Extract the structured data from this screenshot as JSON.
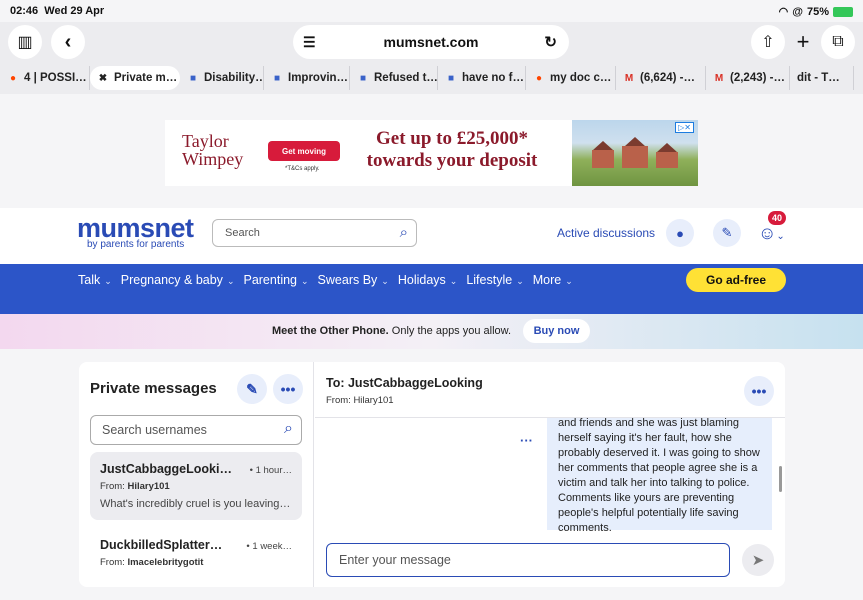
{
  "status": {
    "time": "02:46",
    "date": "Wed 29 Apr",
    "battery": "75%"
  },
  "browser": {
    "url": "mumsnet.com",
    "tabs": [
      {
        "label": "4 | POSSI…",
        "icon": "reddit-icon"
      },
      {
        "label": "Private m…",
        "icon": "close-icon"
      },
      {
        "label": "Disability…",
        "icon": "site-icon"
      },
      {
        "label": "Improvin…",
        "icon": "site-icon"
      },
      {
        "label": "Refused t…",
        "icon": "site-icon"
      },
      {
        "label": "have no f…",
        "icon": "site-icon"
      },
      {
        "label": "my doc c…",
        "icon": "reddit-icon"
      },
      {
        "label": "(6,624) -…",
        "icon": "gmail-icon"
      },
      {
        "label": "(2,243) -…",
        "icon": "gmail-icon"
      },
      {
        "label": "dit - T…",
        "icon": ""
      }
    ]
  },
  "ad": {
    "brand_line1": "Taylor",
    "brand_line2": "Wimpey",
    "cta": "Get moving",
    "terms": "*T&Cs apply.",
    "headline_line1": "Get up to £25,000*",
    "headline_line2": "towards your deposit"
  },
  "header": {
    "logo": "mumsnet",
    "tagline": "by parents for parents",
    "search_placeholder": "Search",
    "active_discussions": "Active discussions",
    "notification_count": "40"
  },
  "nav": {
    "items": [
      "Talk",
      "Pregnancy & baby",
      "Parenting",
      "Swears By",
      "Holidays",
      "Lifestyle",
      "More"
    ],
    "adfree": "Go ad-free"
  },
  "promo": {
    "bold": "Meet the Other Phone.",
    "text": " Only the apps you allow.",
    "button": "Buy now"
  },
  "messages": {
    "title": "Private messages",
    "search_placeholder": "Search usernames",
    "conversations": [
      {
        "name": "JustCabbaggeLooki…",
        "time": "1 hour…",
        "from_label": "From:",
        "from": "Hilary101",
        "preview": "What's incredibly cruel is you leaving…"
      },
      {
        "name": "DuckbilledSplatter…",
        "time": "1 week…",
        "from_label": "From:",
        "from": "Imacelebritygotit"
      }
    ],
    "thread": {
      "to": "To: JustCabbaggeLooking",
      "from": "From: Hilary101",
      "message": "and friends and she was just blaming herself saying it's her fault, how she probably deserved it. I was going to show her comments that people agree she is a victim and talk her into talking to police. Comments like yours are preventing people's helpful potentially life saving comments.",
      "compose_placeholder": "Enter your message"
    }
  },
  "colors": {
    "brand_blue": "#2a4bb5",
    "nav_blue": "#2c55c8",
    "adfree_yellow": "#ffe135",
    "badge_red": "#d71b3b"
  }
}
